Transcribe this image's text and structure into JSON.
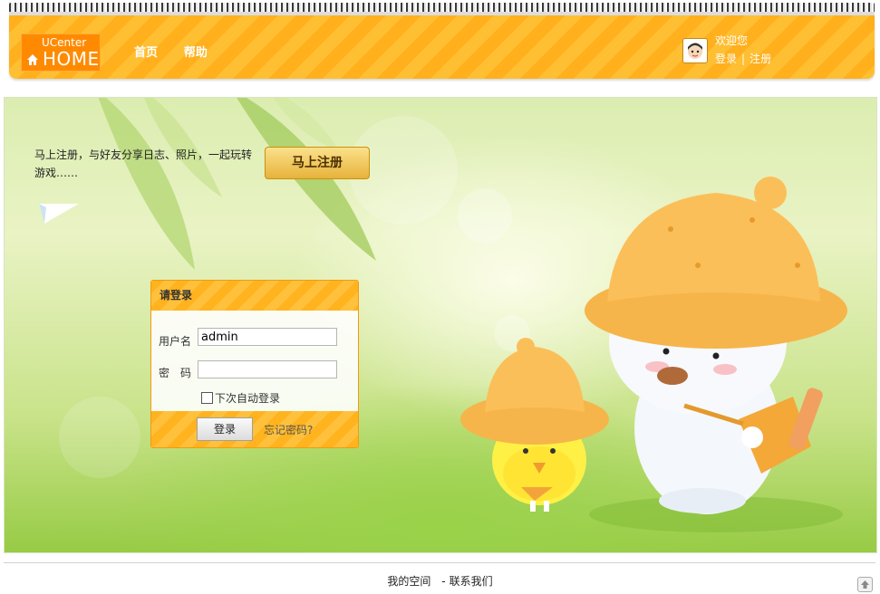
{
  "header": {
    "logo_top": "UCenter",
    "logo_main": "HOME",
    "nav": [
      "首页",
      "帮助"
    ],
    "welcome": "欢迎您",
    "login_link": "登录",
    "separator": "|",
    "register_link": "注册"
  },
  "hero": {
    "promo_text": "马上注册，与好友分享日志、照片，一起玩转游戏……",
    "register_button": "马上注册"
  },
  "login": {
    "title": "请登录",
    "username_label": "用户名",
    "username_value": "admin",
    "password_label": "密　码",
    "remember_label": "下次自动登录",
    "submit_label": "登录",
    "forgot_link": "忘记密码?"
  },
  "footer": {
    "my_space": "我的空间",
    "dash": "-",
    "contact": "联系我们"
  },
  "colors": {
    "header_orange": "#ffb01c",
    "logo_orange": "#ff8a00",
    "login_border": "#f39a0e",
    "hero_green": "#97cb45"
  },
  "icons": [
    "home-icon",
    "user-avatar-icon",
    "back-to-top-icon"
  ]
}
